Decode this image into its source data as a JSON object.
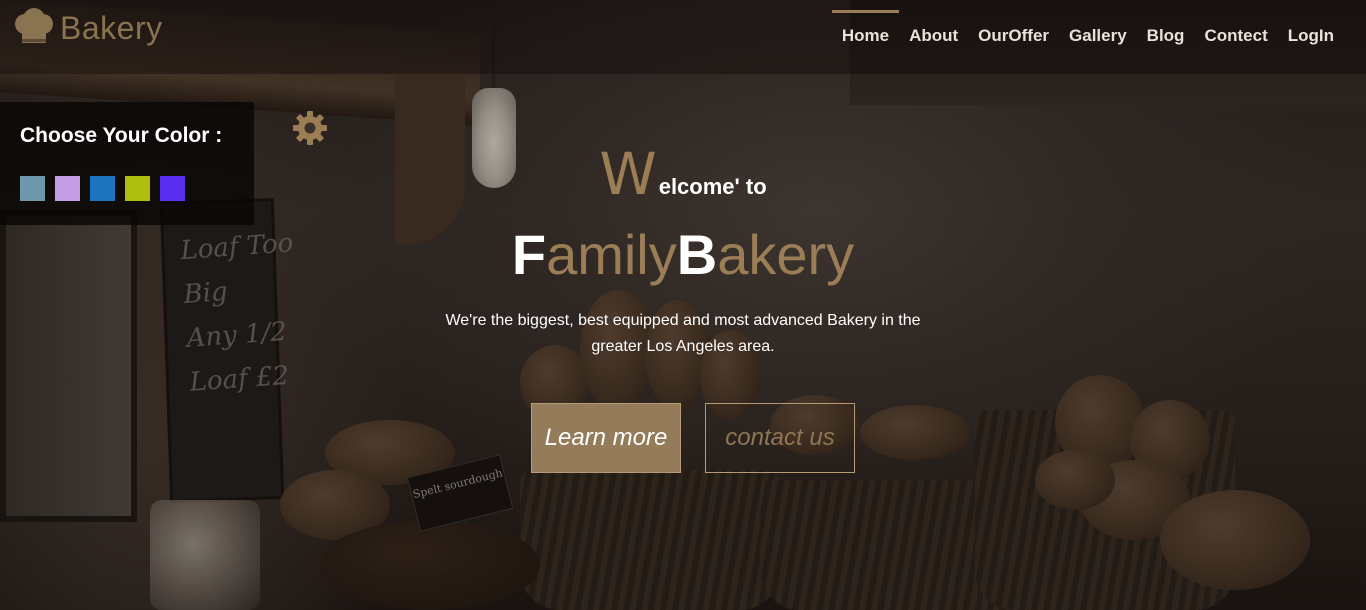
{
  "brand": {
    "name": "Bakery",
    "icon": "chef-hat-icon"
  },
  "nav": {
    "items": [
      {
        "label": "Home",
        "active": true
      },
      {
        "label": "About"
      },
      {
        "label": "OurOffer"
      },
      {
        "label": "Gallery"
      },
      {
        "label": "Blog"
      },
      {
        "label": "Contect"
      },
      {
        "label": "LogIn"
      }
    ]
  },
  "color_chooser": {
    "title": "Choose Your Color :",
    "swatches": [
      "#6f97ab",
      "#c39ee6",
      "#1e73be",
      "#aebf0f",
      "#5b2ff0"
    ],
    "settings_icon": "gear-icon"
  },
  "hero": {
    "welcome_initial": "W",
    "welcome_rest": "elcome' to",
    "title_parts": [
      "F",
      "amily",
      "B",
      "akery"
    ],
    "subtitle": "We're the biggest, best equipped and most advanced Bakery in the greater Los Angeles area.",
    "learn_more": "Learn more",
    "contact_us": "contact us"
  },
  "scene": {
    "chalkboard_text": [
      "Loaf Too",
      "Big",
      "Any 1/2",
      "Loaf £2"
    ],
    "sign_text": "Spelt sourdough"
  },
  "colors": {
    "accent": "#9b7d56",
    "button_fill": "#947b59"
  }
}
